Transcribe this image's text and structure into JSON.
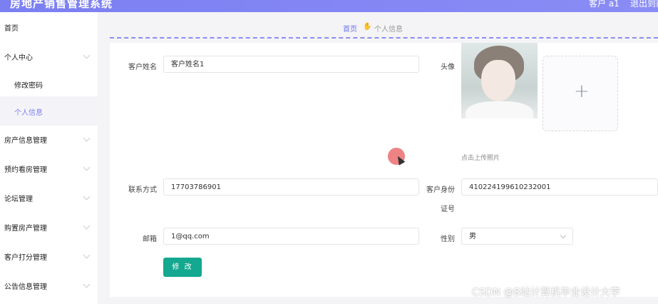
{
  "header": {
    "app_title": "房地产销售管理系统",
    "user_label": "客户 a1",
    "logout_label": "退出到前台"
  },
  "sidebar": {
    "items": [
      {
        "label": "首页"
      },
      {
        "label": "个人中心"
      },
      {
        "label": "修改密码"
      },
      {
        "label": "个人信息"
      },
      {
        "label": "房产信息管理"
      },
      {
        "label": "预约看房管理"
      },
      {
        "label": "论坛管理"
      },
      {
        "label": "购置房产管理"
      },
      {
        "label": "客户打分管理"
      },
      {
        "label": "公告信息管理"
      }
    ]
  },
  "breadcrumb": {
    "home": "首页",
    "current": "个人信息"
  },
  "form": {
    "name_label": "客户姓名",
    "name_value": "客户姓名1",
    "avatar_label": "头像",
    "upload_hint": "点击上传照片",
    "phone_label": "联系方式",
    "phone_value": "17703786901",
    "idcard_label_1": "客户身份",
    "idcard_label_2": "证号",
    "idcard_value": "410224199610232001",
    "email_label": "邮箱",
    "email_value": "1@qq.com",
    "gender_label": "性别",
    "gender_value": "男",
    "submit_label": "修 改"
  },
  "icons": {
    "plus": "plus-icon",
    "chevron": "chevron-down-icon",
    "crumb": "hand-icon"
  },
  "colors": {
    "accent": "#7b7ff2",
    "button": "#13a88f"
  },
  "watermark": "CSDN @B站计算机毕业设计大学"
}
